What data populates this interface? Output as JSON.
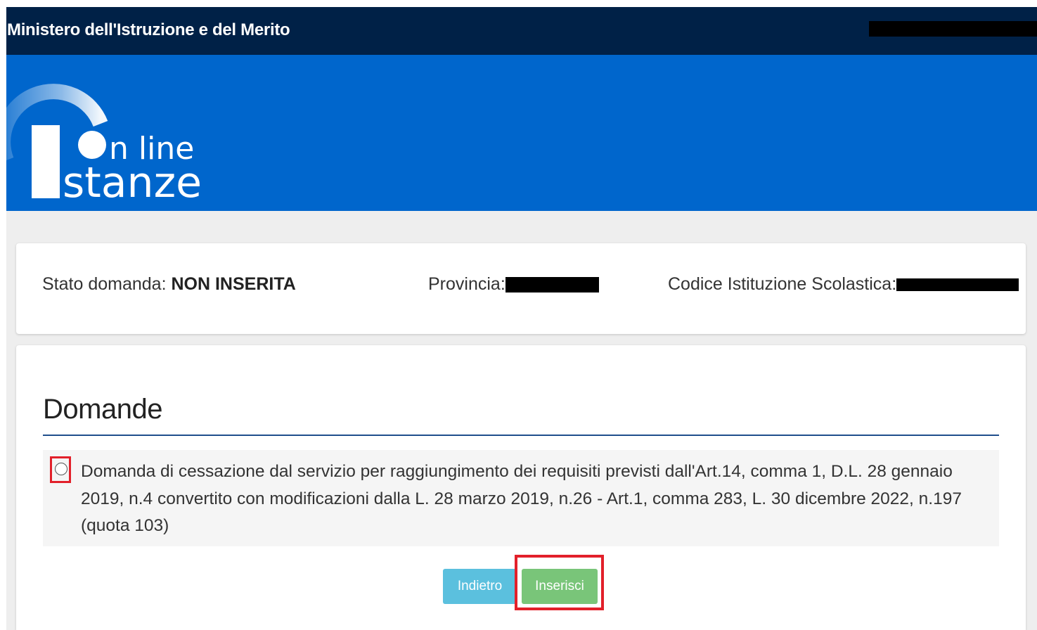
{
  "header": {
    "ministry": "Ministero dell'Istruzione e del Merito"
  },
  "logo": {
    "line1": "n line",
    "line2": "stanze"
  },
  "status": {
    "state_label": "Stato domanda:",
    "state_value": "NON INSERITA",
    "province_label": "Provincia:",
    "school_code_label": "Codice Istituzione Scolastica:"
  },
  "main": {
    "title": "Domande",
    "option_label": "Domanda di cessazione dal servizio per raggiungimento dei requisiti previsti dall'Art.14, comma 1, D.L. 28 gennaio 2019, n.4 convertito con modificazioni dalla L. 28 marzo 2019, n.26 - Art.1, comma 283, L. 30 dicembre 2022, n.197 (quota 103)",
    "back_button": "Indietro",
    "insert_button": "Inserisci"
  },
  "colors": {
    "topbar": "#002147",
    "banner": "#0066cc",
    "back_button": "#5bc0de",
    "insert_button": "#6bbf6b",
    "highlight": "#e2202a"
  }
}
